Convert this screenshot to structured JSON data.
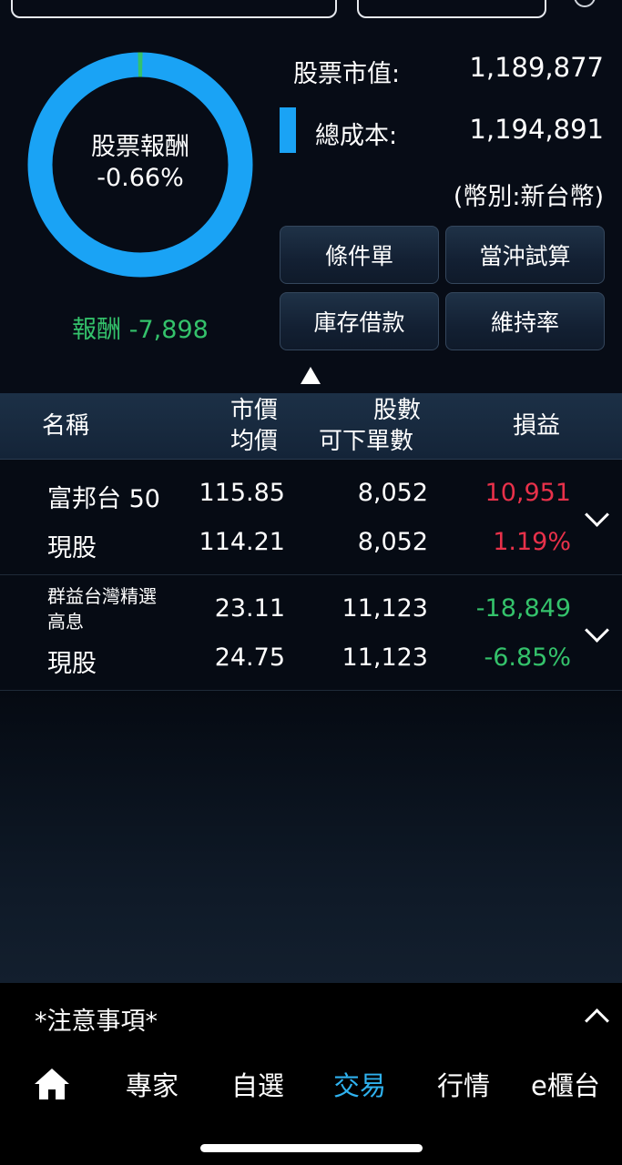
{
  "summary": {
    "donut_title": "股票報酬",
    "donut_percent": "-0.66%",
    "profit_label": "報酬",
    "profit_value": "-7,898",
    "market_value_label": "股票市值:",
    "market_value": "1,189,877",
    "total_cost_label": "總成本:",
    "total_cost": "1,194,891",
    "currency_note": "(幣別:新台幣)",
    "donut_fraction_gain": 0.0066,
    "colors": {
      "ring": "#1aa3f5",
      "segment": "#34c26b"
    }
  },
  "actions": [
    {
      "label": "條件單"
    },
    {
      "label": "當沖試算"
    },
    {
      "label": "庫存借款"
    },
    {
      "label": "維持率"
    }
  ],
  "table": {
    "headers": {
      "name": "名稱",
      "price_top": "市價",
      "price_bottom": "均價",
      "shares_top": "股數",
      "shares_bottom": "可下單數",
      "pnl": "損益"
    },
    "rows": [
      {
        "name": "富邦台 50",
        "type": "現股",
        "market_price": "115.85",
        "avg_price": "114.21",
        "shares": "8,052",
        "orderable": "8,052",
        "pnl": "10,951",
        "pnl_pct": "1.19%",
        "trend": "up"
      },
      {
        "name": "群益台灣精選高息",
        "type": "現股",
        "market_price": "23.11",
        "avg_price": "24.75",
        "shares": "11,123",
        "orderable": "11,123",
        "pnl": "-18,849",
        "pnl_pct": "-6.85%",
        "trend": "down"
      }
    ]
  },
  "notice": {
    "label": "*注意事項*"
  },
  "nav": {
    "items": [
      {
        "label": "專家"
      },
      {
        "label": "自選"
      },
      {
        "label": "交易"
      },
      {
        "label": "行情"
      },
      {
        "label": "e櫃台"
      }
    ],
    "active_color": "#2fb2ef"
  }
}
